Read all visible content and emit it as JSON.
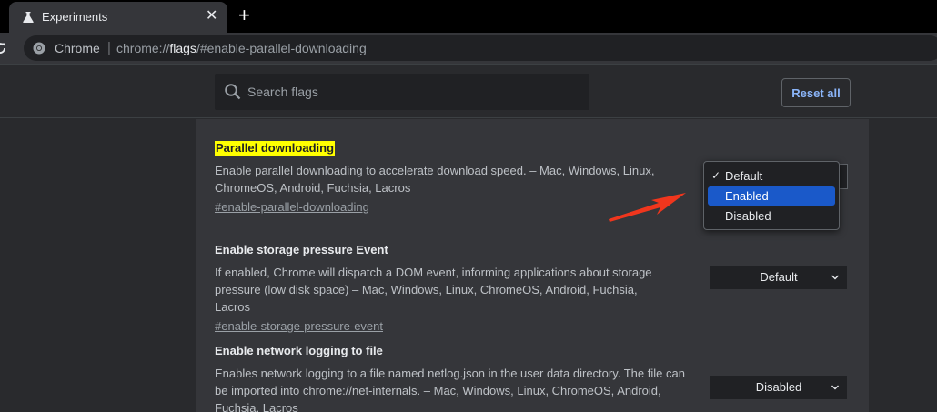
{
  "tab": {
    "title": "Experiments",
    "close": "✕",
    "new_tab": "+"
  },
  "omnibox": {
    "chip": "Chrome",
    "separator": "|",
    "url_prefix": "chrome://",
    "url_host": "flags",
    "url_rest": "/#enable-parallel-downloading"
  },
  "header": {
    "search_placeholder": "Search flags",
    "reset_label": "Reset all"
  },
  "experiments": [
    {
      "title": "Parallel downloading",
      "description": "Enable parallel downloading to accelerate download speed. – Mac, Windows, Linux, ChromeOS, Android, Fuchsia, Lacros",
      "link": "#enable-parallel-downloading",
      "value": "Default"
    },
    {
      "title": "Enable storage pressure Event",
      "description": "If enabled, Chrome will dispatch a DOM event, informing applications about storage pressure (low disk space) – Mac, Windows, Linux, ChromeOS, Android, Fuchsia, Lacros",
      "link": "#enable-storage-pressure-event",
      "value": "Default"
    },
    {
      "title": "Enable network logging to file",
      "description": "Enables network logging to a file named netlog.json in the user data directory. The file can be imported into chrome://net-internals. – Mac, Windows, Linux, ChromeOS, Android, Fuchsia, Lacros",
      "value": "Disabled"
    }
  ],
  "dropdown": {
    "options": [
      "Default",
      "Enabled",
      "Disabled"
    ],
    "checkmark": "✓",
    "highlighted": "Enabled"
  },
  "colors": {
    "accent": "#8ab4f8",
    "highlight": "#ffff00",
    "selection": "#1a59c9",
    "arrow": "#f0361d"
  }
}
